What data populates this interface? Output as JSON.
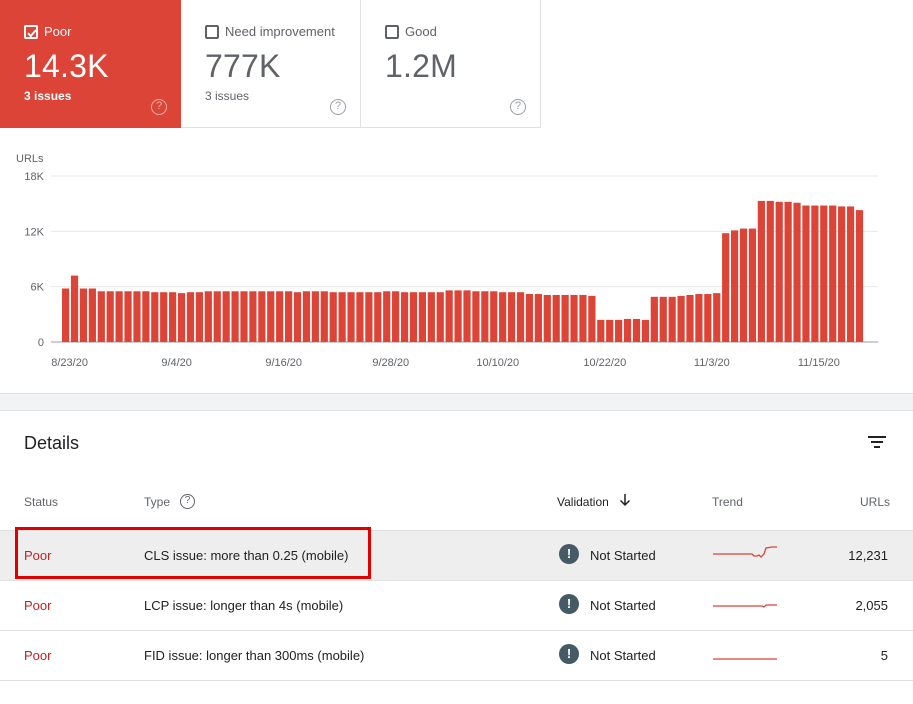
{
  "tiles": [
    {
      "label": "Poor",
      "value": "14.3K",
      "issues": "3 issues",
      "help": "?",
      "checked": true
    },
    {
      "label": "Need improvement",
      "value": "777K",
      "issues": "3 issues",
      "help": "?",
      "checked": false
    },
    {
      "label": "Good",
      "value": "1.2M",
      "issues": "",
      "help": "?",
      "checked": false
    }
  ],
  "chart_data": {
    "type": "bar",
    "ylabel": "URLs",
    "y_ticks": [
      "18K",
      "12K",
      "6K",
      "0"
    ],
    "ylim": [
      0,
      18000
    ],
    "x_tick_labels": [
      "8/23/20",
      "9/4/20",
      "9/16/20",
      "9/28/20",
      "10/10/20",
      "10/22/20",
      "11/3/20",
      "11/15/20"
    ],
    "x_tick_indices": [
      0,
      12,
      24,
      36,
      48,
      60,
      72,
      84
    ],
    "color": "#db4437",
    "values": [
      5800,
      7200,
      5800,
      5800,
      5500,
      5500,
      5500,
      5500,
      5500,
      5500,
      5400,
      5400,
      5400,
      5300,
      5400,
      5400,
      5500,
      5500,
      5500,
      5500,
      5500,
      5500,
      5500,
      5500,
      5500,
      5500,
      5400,
      5500,
      5500,
      5500,
      5400,
      5400,
      5400,
      5400,
      5400,
      5400,
      5500,
      5500,
      5400,
      5400,
      5400,
      5400,
      5400,
      5600,
      5600,
      5600,
      5500,
      5500,
      5500,
      5400,
      5400,
      5400,
      5200,
      5200,
      5100,
      5100,
      5100,
      5100,
      5100,
      5000,
      2400,
      2400,
      2400,
      2500,
      2500,
      2400,
      4900,
      4900,
      4900,
      5000,
      5100,
      5200,
      5200,
      5300,
      11800,
      12100,
      12300,
      12300,
      15300,
      15300,
      15200,
      15200,
      15100,
      14800,
      14800,
      14800,
      14800,
      14700,
      14700,
      14300
    ]
  },
  "details": {
    "title": "Details",
    "headers": {
      "status": "Status",
      "type": "Type",
      "validation": "Validation",
      "trend": "Trend",
      "urls": "URLs"
    },
    "type_help": "?",
    "rows": [
      {
        "status": "Poor",
        "type": "CLS issue: more than 0.25 (mobile)",
        "validation_icon": "!",
        "validation": "Not Started",
        "urls": "12,231"
      },
      {
        "status": "Poor",
        "type": "LCP issue: longer than 4s (mobile)",
        "validation_icon": "!",
        "validation": "Not Started",
        "urls": "2,055"
      },
      {
        "status": "Poor",
        "type": "FID issue: longer than 300ms (mobile)",
        "validation_icon": "!",
        "validation": "Not Started",
        "urls": "5"
      }
    ]
  }
}
